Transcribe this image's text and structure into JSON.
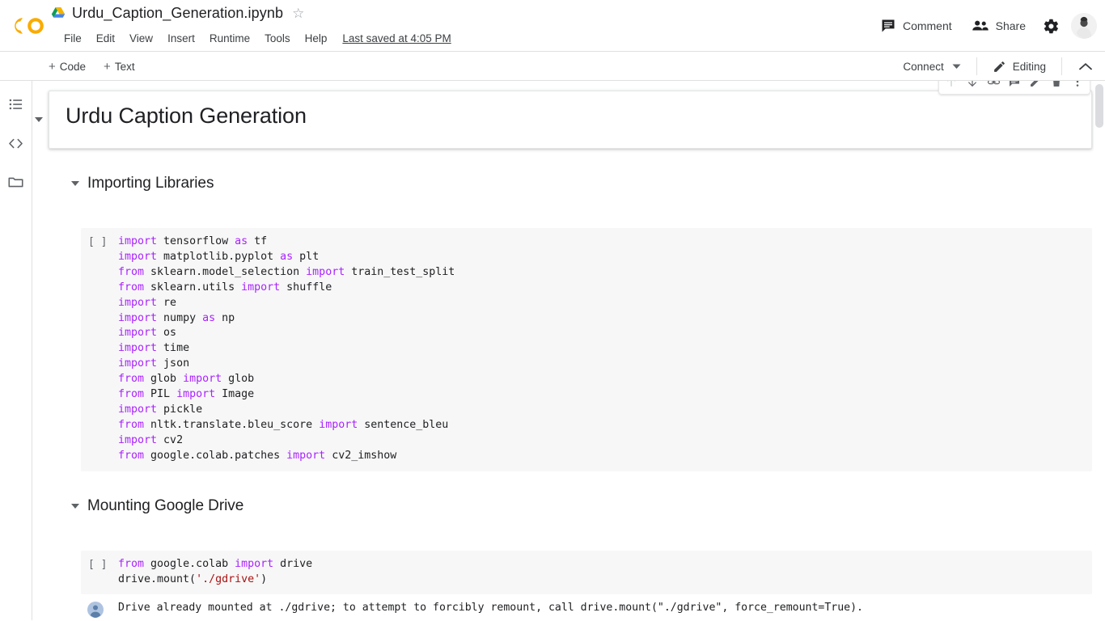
{
  "app": {
    "logo_text": "CO",
    "logo_color": "#F9AB00"
  },
  "header": {
    "file_name": "Urdu_Caption_Generation.ipynb",
    "star_glyph": "☆",
    "menus": [
      "File",
      "Edit",
      "View",
      "Insert",
      "Runtime",
      "Tools",
      "Help"
    ],
    "last_saved": "Last saved at 4:05 PM",
    "comment_label": "Comment",
    "share_label": "Share"
  },
  "toolbar": {
    "add_code_label": "Code",
    "add_text_label": "Text",
    "plus_glyph": "+",
    "connect_label": "Connect",
    "editing_label": "Editing"
  },
  "sidebar": {
    "items": [
      {
        "name": "table-of-contents",
        "label": "Table of contents"
      },
      {
        "name": "code-snippets",
        "label": "Code snippets"
      },
      {
        "name": "files",
        "label": "Files"
      }
    ]
  },
  "cell_toolbar": {
    "buttons": [
      {
        "name": "move-cell-up",
        "label": "Move cell up",
        "disabled": true
      },
      {
        "name": "move-cell-down",
        "label": "Move cell down",
        "disabled": false
      },
      {
        "name": "link-to-cell",
        "label": "Link to cell",
        "disabled": false
      },
      {
        "name": "add-comment",
        "label": "Add a comment",
        "disabled": false
      },
      {
        "name": "edit-cell",
        "label": "Edit",
        "disabled": false
      },
      {
        "name": "delete-cell",
        "label": "Delete cell",
        "disabled": false
      },
      {
        "name": "more-cell-actions",
        "label": "More cell actions",
        "disabled": false
      }
    ]
  },
  "notebook": {
    "title_cell": {
      "heading": "Urdu Caption Generation"
    },
    "section_1": {
      "heading": "Importing Libraries",
      "cell_prompt": "[ ]",
      "code_lines": [
        [
          {
            "t": "import",
            "c": "kw"
          },
          {
            "t": " tensorflow ",
            "c": ""
          },
          {
            "t": "as",
            "c": "kw"
          },
          {
            "t": " tf",
            "c": ""
          }
        ],
        [
          {
            "t": "import",
            "c": "kw"
          },
          {
            "t": " matplotlib.pyplot ",
            "c": ""
          },
          {
            "t": "as",
            "c": "kw"
          },
          {
            "t": " plt",
            "c": ""
          }
        ],
        [
          {
            "t": "from",
            "c": "kw"
          },
          {
            "t": " sklearn.model_selection ",
            "c": ""
          },
          {
            "t": "import",
            "c": "kw"
          },
          {
            "t": " train_test_split",
            "c": ""
          }
        ],
        [
          {
            "t": "from",
            "c": "kw"
          },
          {
            "t": " sklearn.utils ",
            "c": ""
          },
          {
            "t": "import",
            "c": "kw"
          },
          {
            "t": " shuffle",
            "c": ""
          }
        ],
        [
          {
            "t": "import",
            "c": "kw"
          },
          {
            "t": " re",
            "c": ""
          }
        ],
        [
          {
            "t": "import",
            "c": "kw"
          },
          {
            "t": " numpy ",
            "c": ""
          },
          {
            "t": "as",
            "c": "kw"
          },
          {
            "t": " np",
            "c": ""
          }
        ],
        [
          {
            "t": "import",
            "c": "kw"
          },
          {
            "t": " os",
            "c": ""
          }
        ],
        [
          {
            "t": "import",
            "c": "kw"
          },
          {
            "t": " time",
            "c": ""
          }
        ],
        [
          {
            "t": "import",
            "c": "kw"
          },
          {
            "t": " json",
            "c": ""
          }
        ],
        [
          {
            "t": "from",
            "c": "kw"
          },
          {
            "t": " glob ",
            "c": ""
          },
          {
            "t": "import",
            "c": "kw"
          },
          {
            "t": " glob",
            "c": ""
          }
        ],
        [
          {
            "t": "from",
            "c": "kw"
          },
          {
            "t": " PIL ",
            "c": ""
          },
          {
            "t": "import",
            "c": "kw"
          },
          {
            "t": " Image",
            "c": ""
          }
        ],
        [
          {
            "t": "import",
            "c": "kw"
          },
          {
            "t": " pickle",
            "c": ""
          }
        ],
        [
          {
            "t": "from",
            "c": "kw"
          },
          {
            "t": " nltk.translate.bleu_score ",
            "c": ""
          },
          {
            "t": "import",
            "c": "kw"
          },
          {
            "t": " sentence_bleu",
            "c": ""
          }
        ],
        [
          {
            "t": "import",
            "c": "kw"
          },
          {
            "t": " cv2",
            "c": ""
          }
        ],
        [
          {
            "t": "from",
            "c": "kw"
          },
          {
            "t": " google.colab.patches ",
            "c": ""
          },
          {
            "t": "import",
            "c": "kw"
          },
          {
            "t": " cv2_imshow",
            "c": ""
          }
        ]
      ]
    },
    "section_2": {
      "heading": "Mounting Google Drive",
      "cell_prompt": "[ ]",
      "code_lines": [
        [
          {
            "t": "from",
            "c": "kw"
          },
          {
            "t": " google.colab ",
            "c": ""
          },
          {
            "t": "import",
            "c": "kw"
          },
          {
            "t": " drive",
            "c": ""
          }
        ],
        [
          {
            "t": "drive.mount(",
            "c": ""
          },
          {
            "t": "'./gdrive'",
            "c": "str"
          },
          {
            "t": ")",
            "c": ""
          }
        ]
      ],
      "output_text": "Drive already mounted at ./gdrive; to attempt to forcibly remount, call drive.mount(\"./gdrive\", force_remount=True)."
    }
  },
  "colors": {
    "accent": "#F9AB00",
    "keyword": "#aa22ff",
    "string": "#aa1111",
    "code_bg": "#f7f7f7",
    "text": "#202124"
  }
}
